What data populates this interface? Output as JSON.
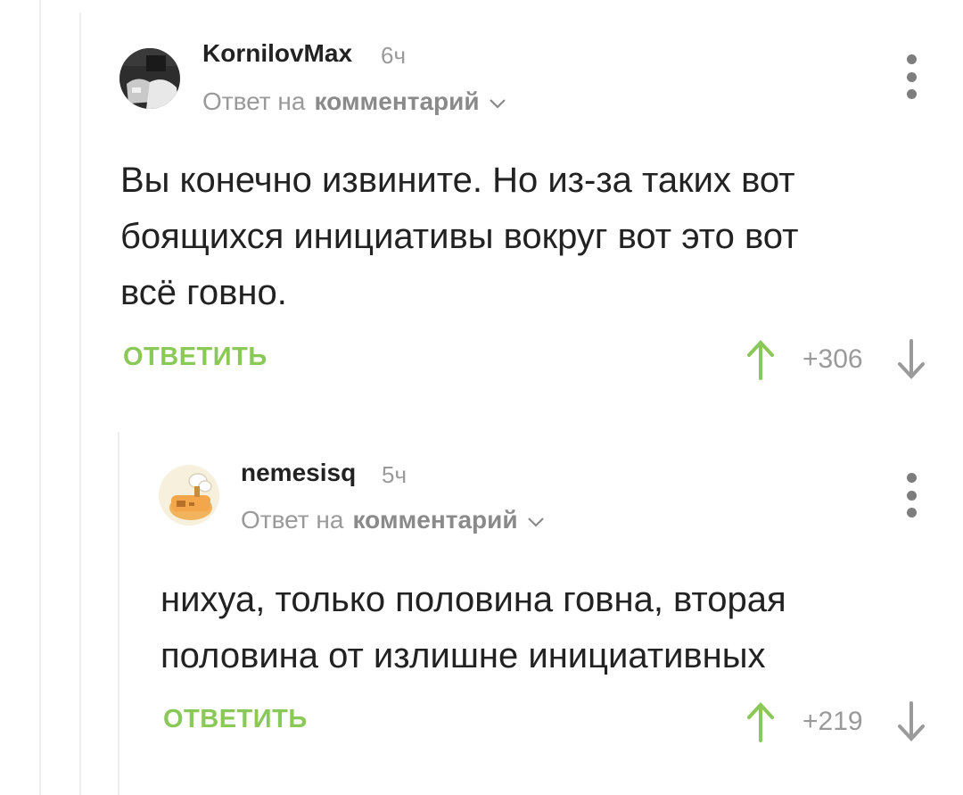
{
  "comments": [
    {
      "author": "KornilovMax",
      "time": "6ч",
      "reply_prefix": "Ответ на",
      "reply_link": "комментарий",
      "text_lines": [
        "Вы конечно извините. Но из-за таких вот",
        "боящихся инициативы вокруг вот это вот",
        "всё говно."
      ],
      "reply_label": "ОТВЕТИТЬ",
      "rating": "+306"
    },
    {
      "author": "nemesisq",
      "time": "5ч",
      "reply_prefix": "Ответ на",
      "reply_link": "комментарий",
      "text_lines": [
        "нихуа, только половина говна, вторая",
        "половина от излишне инициативных"
      ],
      "reply_label": "ОТВЕТИТЬ",
      "rating": "+219"
    }
  ],
  "colors": {
    "accent_green": "#8ac858",
    "vote_up": "#8ac858",
    "vote_down": "#9a9a9a",
    "muted": "#9a9a9a"
  },
  "icons": {
    "menu": "vertical-dots-icon",
    "chevron": "chevron-down-icon",
    "upvote": "arrow-up-icon",
    "downvote": "arrow-down-icon"
  }
}
